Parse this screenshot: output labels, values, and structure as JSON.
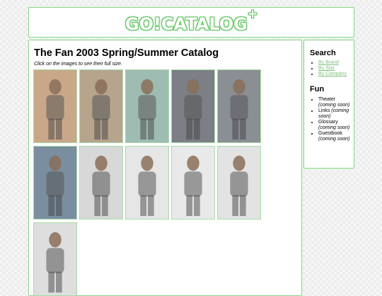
{
  "header": {
    "logo_text": "GO!CATALOG",
    "logo_plus": "+"
  },
  "main": {
    "title": "The Fan 2003 Spring/Summer Catalog",
    "hint": "Click on the images to see their full size.",
    "thumbnails": [
      {
        "bg": "#c9a88a"
      },
      {
        "bg": "#b7a48d"
      },
      {
        "bg": "#9fbcb2"
      },
      {
        "bg": "#7c7f86"
      },
      {
        "bg": "#8a8f94"
      },
      {
        "bg": "#7a8ea0"
      },
      {
        "bg": "#d8d8d8"
      },
      {
        "bg": "#e6e6e6"
      },
      {
        "bg": "#e9e9e9"
      },
      {
        "bg": "#e3e3e3"
      },
      {
        "bg": "#dedede"
      }
    ]
  },
  "sidebar": {
    "search_heading": "Search",
    "search_links": [
      "By Brand",
      "By Star",
      "By Company"
    ],
    "fun_heading": "Fun",
    "fun_items": [
      {
        "label": "Theater",
        "note": "(coming soon)"
      },
      {
        "label": "Links",
        "note": "(coming soon)"
      },
      {
        "label": "Glossary",
        "note": "(coming soon)"
      },
      {
        "label": "Guestbook",
        "note": "(coming soon)"
      }
    ]
  },
  "colors": {
    "accent_green": "#8fd38f",
    "link_green": "#7fbf7f"
  }
}
